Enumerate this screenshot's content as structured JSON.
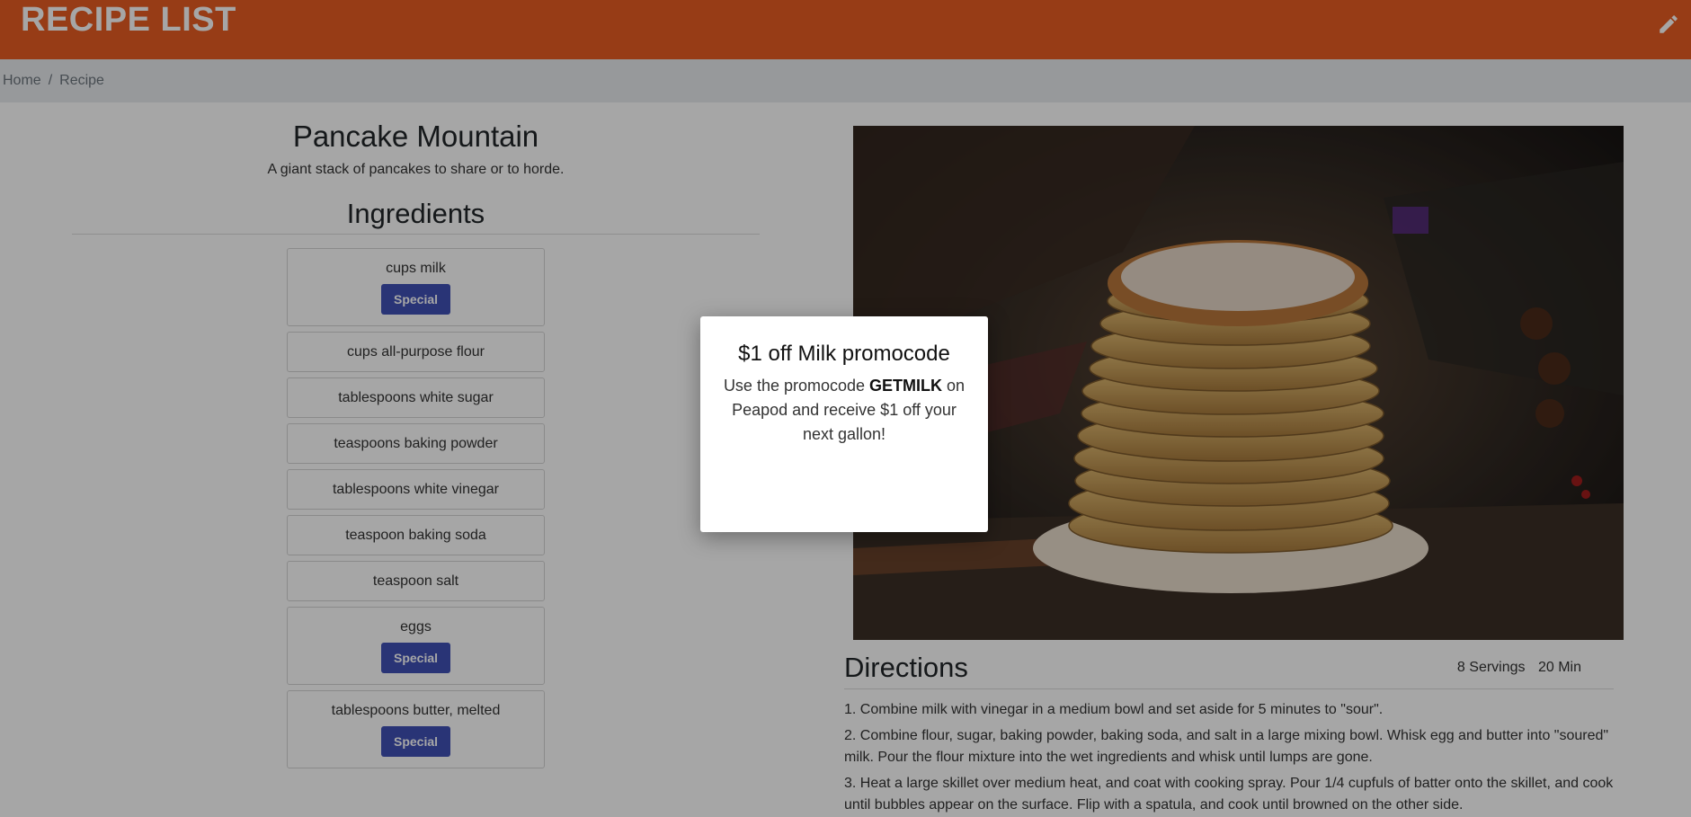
{
  "header": {
    "brand": "RECIPE LIST",
    "edit_icon": "pencil-icon",
    "color": "#e85d22"
  },
  "breadcrumb": {
    "home": "Home",
    "separator": "/",
    "current": "Recipe"
  },
  "recipe": {
    "title": "Pancake Mountain",
    "description": "A giant stack of pancakes to share or to horde.",
    "ingredients_heading": "Ingredients",
    "special_label": "Special",
    "ingredients": [
      {
        "name": "cups milk",
        "special": true
      },
      {
        "name": "cups all-purpose flour",
        "special": false
      },
      {
        "name": "tablespoons white sugar",
        "special": false
      },
      {
        "name": "teaspoons baking powder",
        "special": false
      },
      {
        "name": "tablespoons white vinegar",
        "special": false
      },
      {
        "name": "teaspoon baking soda",
        "special": false
      },
      {
        "name": "teaspoon salt",
        "special": false
      },
      {
        "name": "eggs",
        "special": true
      },
      {
        "name": "tablespoons butter, melted",
        "special": true
      }
    ],
    "directions_heading": "Directions",
    "servings": "8 Servings",
    "time": "20 Min",
    "directions": [
      "1. Combine milk with vinegar in a medium bowl and set aside for 5 minutes to \"sour\".",
      "2. Combine flour, sugar, baking powder, baking soda, and salt in a large mixing bowl. Whisk egg and butter into \"soured\" milk. Pour the flour mixture into the wet ingredients and whisk until lumps are gone.",
      "3. Heat a large skillet over medium heat, and coat with cooking spray. Pour 1/4 cupfuls of batter onto the skillet, and cook until bubbles appear on the surface. Flip with a spatula, and cook until browned on the other side."
    ]
  },
  "modal": {
    "title": "$1 off Milk promocode",
    "body_prefix": "Use the promocode ",
    "code": "GETMILK",
    "body_suffix": " on Peapod and receive $1 off your next gallon!"
  },
  "colors": {
    "accent": "#e85d22",
    "special_button": "#3f51b5"
  }
}
